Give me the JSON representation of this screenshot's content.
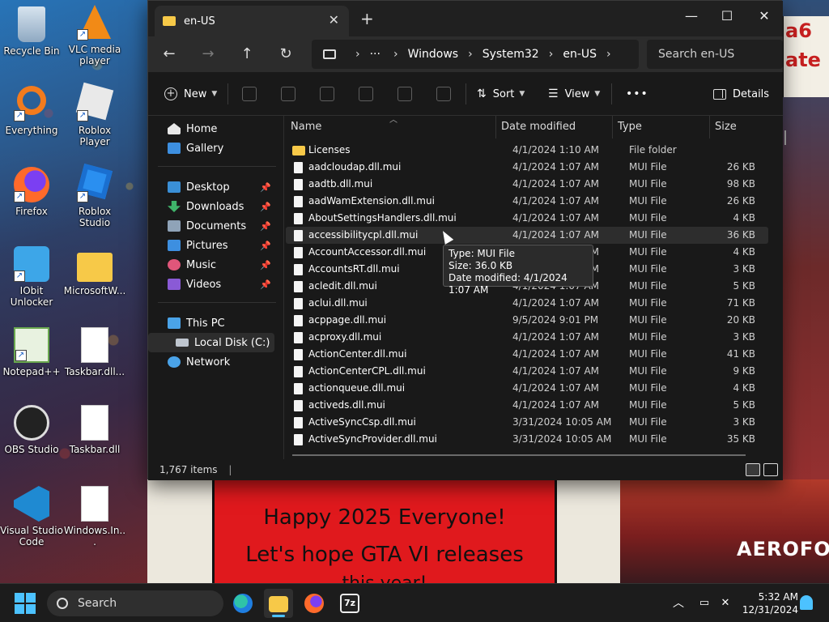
{
  "desktop": {
    "icons": [
      {
        "label": "Recycle Bin",
        "icon": "recycle-bin-icon"
      },
      {
        "label": "VLC media player",
        "icon": "vlc-icon"
      },
      {
        "label": "Everything",
        "icon": "everything-icon"
      },
      {
        "label": "Roblox Player",
        "icon": "roblox-icon"
      },
      {
        "label": "Firefox",
        "icon": "firefox-icon"
      },
      {
        "label": "Roblox Studio",
        "icon": "roblox-studio-icon"
      },
      {
        "label": "IObit Unlocker",
        "icon": "iobit-unlocker-icon"
      },
      {
        "label": "MicrosoftW...",
        "icon": "folder-icon"
      },
      {
        "label": "Notepad++",
        "icon": "notepad-plus-plus-icon"
      },
      {
        "label": "Taskbar.dll...",
        "icon": "file-icon"
      },
      {
        "label": "OBS Studio",
        "icon": "obs-icon"
      },
      {
        "label": "Taskbar.dll",
        "icon": "dll-file-icon"
      },
      {
        "label": "Visual Studio Code",
        "icon": "vscode-icon"
      },
      {
        "label": "Windows.In...",
        "icon": "dll-file-icon"
      }
    ],
    "wallpaper": {
      "poster_line1": "Happy 2025 Everyone!",
      "poster_line2": "Let's hope GTA VI releases",
      "poster_line3": "this year!",
      "sign_text": "a6\nate",
      "brand_text": "AEROFOS"
    }
  },
  "window": {
    "tab_title": "en-US",
    "breadcrumbs": [
      "Windows",
      "System32",
      "en-US"
    ],
    "search_placeholder": "Search en-US",
    "commands": {
      "new": "New",
      "sort": "Sort",
      "view": "View",
      "more": "•••",
      "details": "Details"
    },
    "nav": {
      "home": "Home",
      "gallery": "Gallery",
      "desktop": "Desktop",
      "downloads": "Downloads",
      "documents": "Documents",
      "pictures": "Pictures",
      "music": "Music",
      "videos": "Videos",
      "this_pc": "This PC",
      "local_disk": "Local Disk (C:)",
      "network": "Network"
    },
    "columns": {
      "name": "Name",
      "date": "Date modified",
      "type": "Type",
      "size": "Size"
    },
    "files": [
      {
        "name": "Licenses",
        "date": "4/1/2024 1:10 AM",
        "type": "File folder",
        "size": ""
      },
      {
        "name": "aadcloudap.dll.mui",
        "date": "4/1/2024 1:07 AM",
        "type": "MUI File",
        "size": "26 KB"
      },
      {
        "name": "aadtb.dll.mui",
        "date": "4/1/2024 1:07 AM",
        "type": "MUI File",
        "size": "98 KB"
      },
      {
        "name": "aadWamExtension.dll.mui",
        "date": "4/1/2024 1:07 AM",
        "type": "MUI File",
        "size": "26 KB"
      },
      {
        "name": "AboutSettingsHandlers.dll.mui",
        "date": "4/1/2024 1:07 AM",
        "type": "MUI File",
        "size": "4 KB"
      },
      {
        "name": "accessibilitycpl.dll.mui",
        "date": "4/1/2024 1:07 AM",
        "type": "MUI File",
        "size": "36 KB"
      },
      {
        "name": "AccountAccessor.dll.mui",
        "date": "4/1/2024 1:07 AM",
        "type": "MUI File",
        "size": "4 KB"
      },
      {
        "name": "AccountsRT.dll.mui",
        "date": "4/1/2024 1:07 AM",
        "type": "MUI File",
        "size": "3 KB"
      },
      {
        "name": "acledit.dll.mui",
        "date": "4/1/2024 1:07 AM",
        "type": "MUI File",
        "size": "5 KB"
      },
      {
        "name": "aclui.dll.mui",
        "date": "4/1/2024 1:07 AM",
        "type": "MUI File",
        "size": "71 KB"
      },
      {
        "name": "acppage.dll.mui",
        "date": "9/5/2024 9:01 PM",
        "type": "MUI File",
        "size": "20 KB"
      },
      {
        "name": "acproxy.dll.mui",
        "date": "4/1/2024 1:07 AM",
        "type": "MUI File",
        "size": "3 KB"
      },
      {
        "name": "ActionCenter.dll.mui",
        "date": "4/1/2024 1:07 AM",
        "type": "MUI File",
        "size": "41 KB"
      },
      {
        "name": "ActionCenterCPL.dll.mui",
        "date": "4/1/2024 1:07 AM",
        "type": "MUI File",
        "size": "9 KB"
      },
      {
        "name": "actionqueue.dll.mui",
        "date": "4/1/2024 1:07 AM",
        "type": "MUI File",
        "size": "4 KB"
      },
      {
        "name": "activeds.dll.mui",
        "date": "4/1/2024 1:07 AM",
        "type": "MUI File",
        "size": "5 KB"
      },
      {
        "name": "ActiveSyncCsp.dll.mui",
        "date": "3/31/2024 10:05 AM",
        "type": "MUI File",
        "size": "3 KB"
      },
      {
        "name": "ActiveSyncProvider.dll.mui",
        "date": "3/31/2024 10:05 AM",
        "type": "MUI File",
        "size": "35 KB"
      }
    ],
    "tooltip": {
      "type": "Type: MUI File",
      "size": "Size: 36.0 KB",
      "date": "Date modified: 4/1/2024 1:07 AM"
    },
    "status": {
      "count": "1,767 items",
      "separator": "|"
    }
  },
  "taskbar": {
    "search_label": "Search",
    "time": "5:32 AM",
    "date": "12/31/2024",
    "apps": [
      "edge-icon",
      "file-explorer-icon",
      "firefox-icon",
      "7zip-icon"
    ]
  },
  "colors": {
    "accent": "#4cc2ff",
    "window_bg": "#191919",
    "folder": "#f7c948"
  }
}
